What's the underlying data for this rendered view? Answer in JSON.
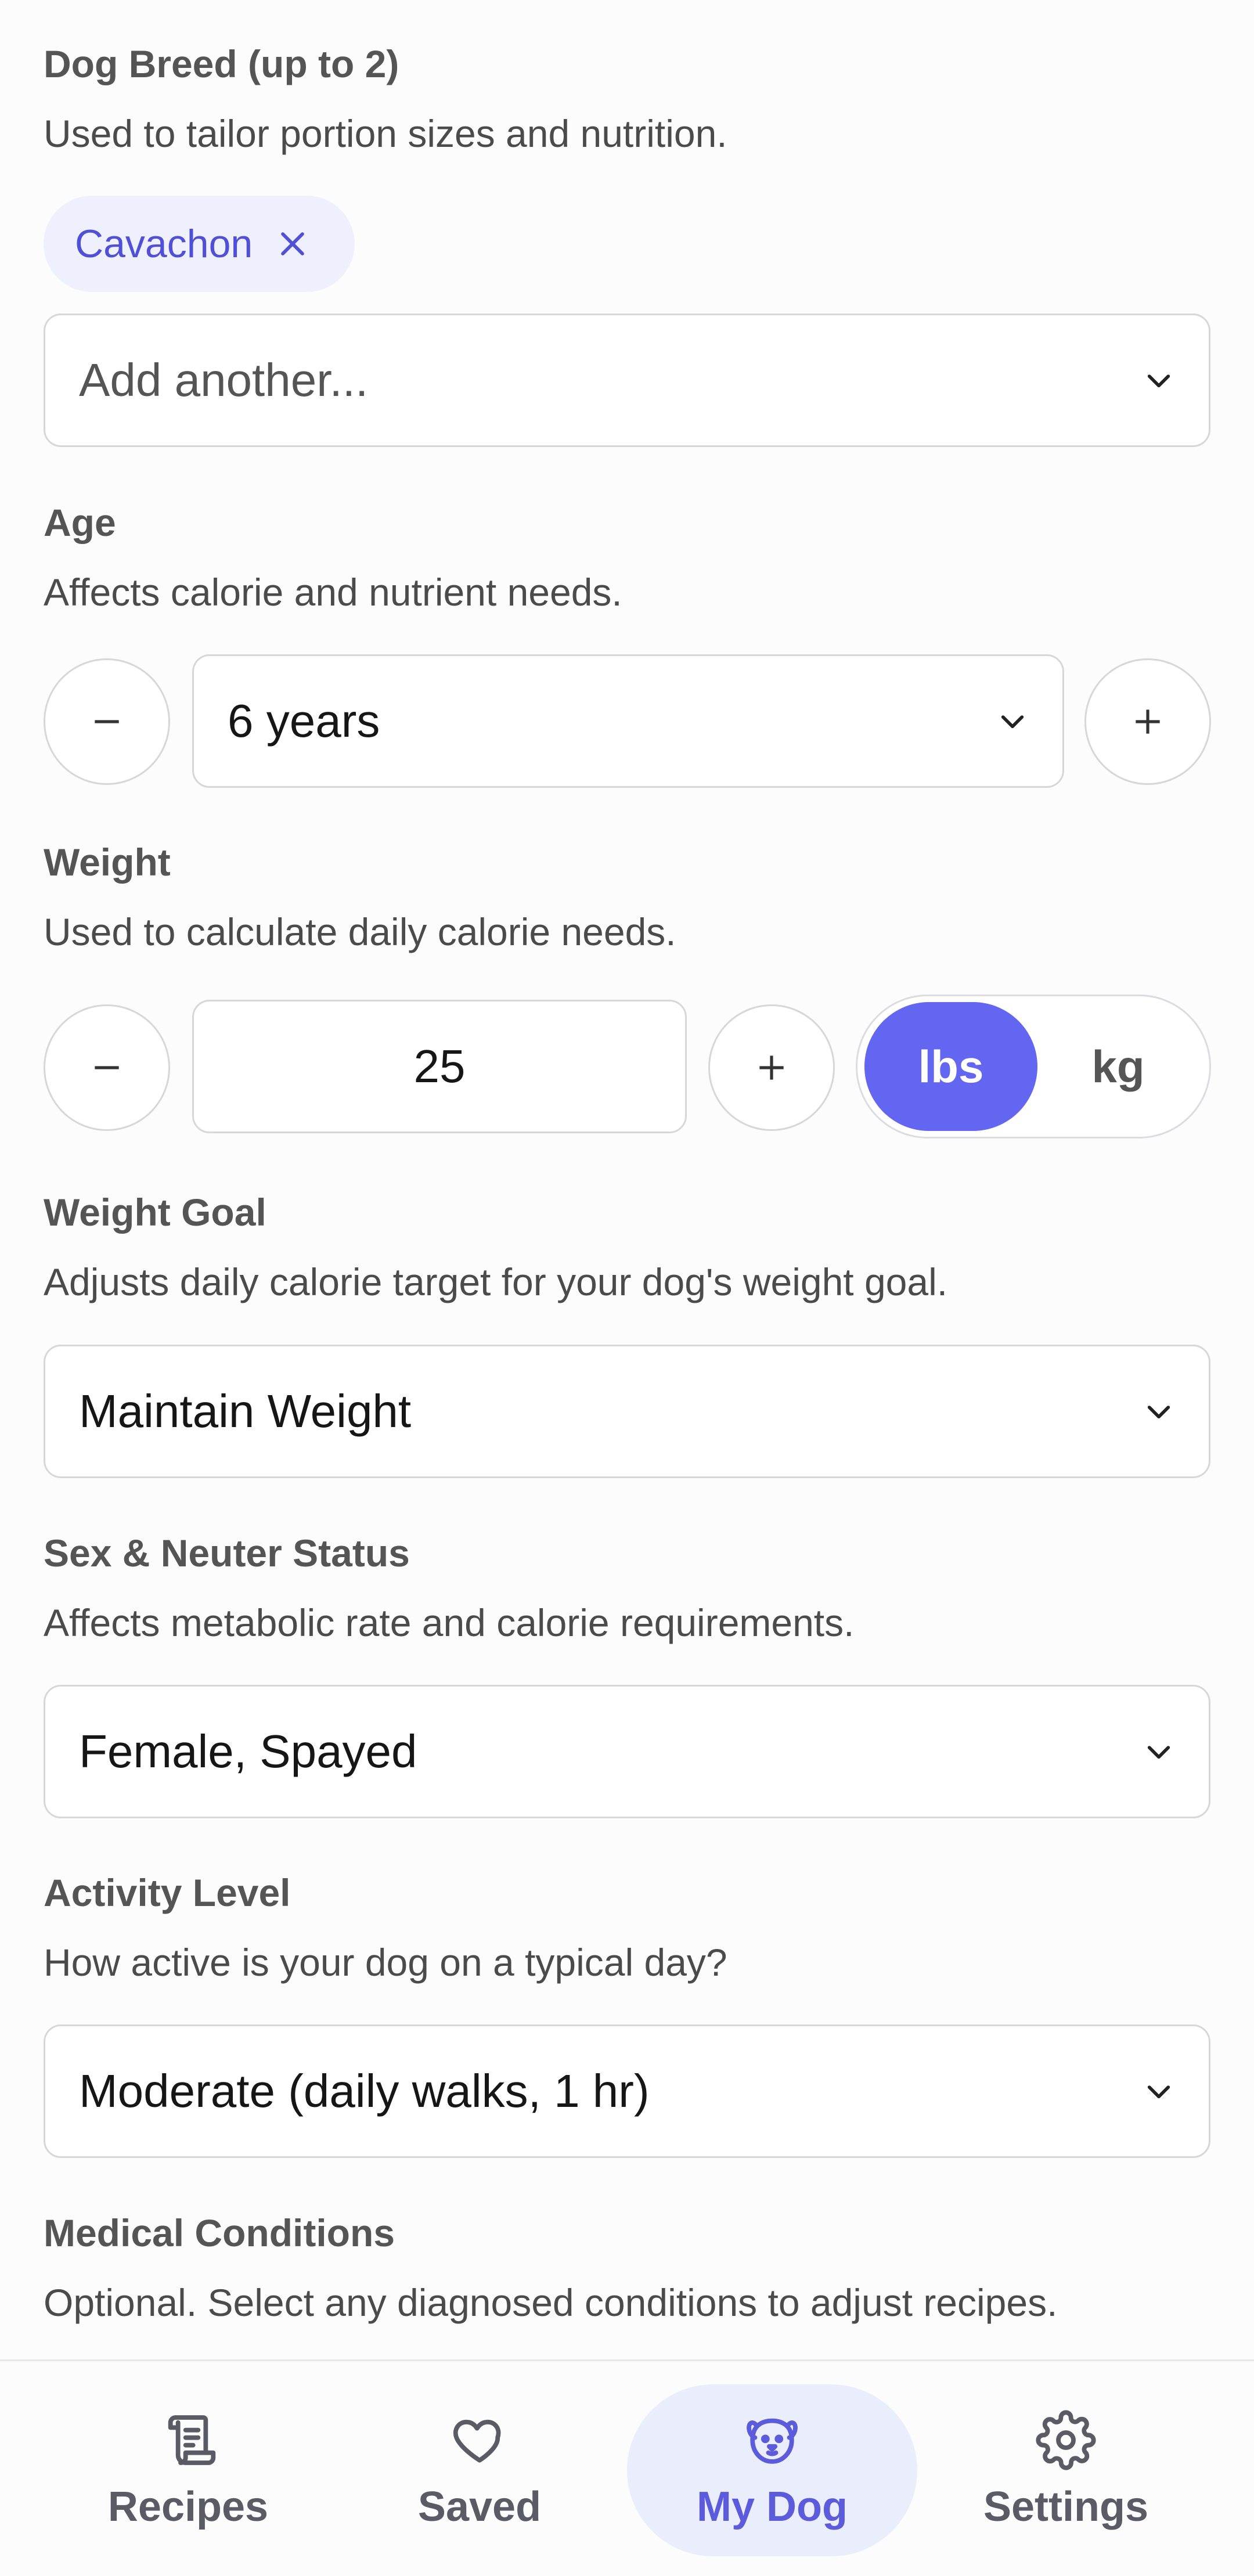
{
  "breed": {
    "label": "Dog Breed (up to 2)",
    "description": "Used to tailor portion sizes and nutrition.",
    "selected_chip": "Cavachon",
    "add_placeholder": "Add another..."
  },
  "age": {
    "label": "Age",
    "description": "Affects calorie and nutrient needs.",
    "value": "6 years"
  },
  "weight": {
    "label": "Weight",
    "description": "Used to calculate daily calorie needs.",
    "value": "25",
    "unit_options": [
      "lbs",
      "kg"
    ],
    "selected_unit": "lbs"
  },
  "weight_goal": {
    "label": "Weight Goal",
    "description": "Adjusts daily calorie target for your dog's weight goal.",
    "value": "Maintain Weight"
  },
  "sex": {
    "label": "Sex & Neuter Status",
    "description": "Affects metabolic rate and calorie requirements.",
    "value": "Female, Spayed"
  },
  "activity": {
    "label": "Activity Level",
    "description": "How active is your dog on a typical day?",
    "value": "Moderate (daily walks, 1 hr)"
  },
  "medical": {
    "label": "Medical Conditions",
    "description": "Optional. Select any diagnosed conditions to adjust recipes."
  },
  "nav": {
    "items": [
      {
        "label": "Recipes",
        "icon": "recipes-icon"
      },
      {
        "label": "Saved",
        "icon": "heart-icon"
      },
      {
        "label": "My Dog",
        "icon": "dog-icon",
        "active": true
      },
      {
        "label": "Settings",
        "icon": "gear-icon"
      }
    ]
  },
  "colors": {
    "accent": "#6366f1",
    "accent_soft": "#eef1fd",
    "nav_active": "#5b5bdc"
  }
}
